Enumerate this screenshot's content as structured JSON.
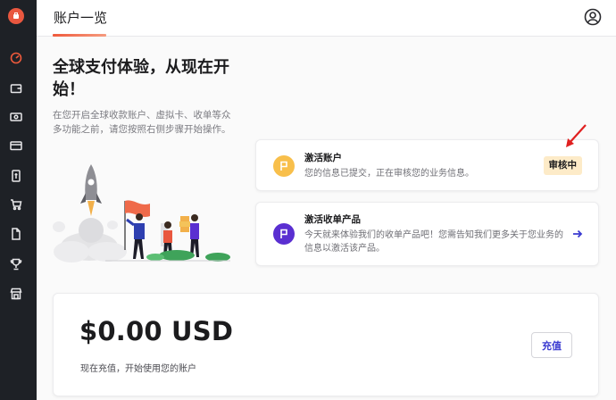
{
  "header": {
    "title": "账户一览"
  },
  "hero": {
    "title": "全球支付体验，从现在开始！",
    "description": "在您开启全球收款账户、虚拟卡、收单等众多功能之前，请您按照右侧步骤开始操作。"
  },
  "tasks": [
    {
      "title": "激活账户",
      "description": "您的信息已提交，正在审核您的业务信息。",
      "status": "审核中",
      "icon": "flag-icon"
    },
    {
      "title": "激活收单产品",
      "description": "今天就来体验我们的收单产品吧！您需告知我们更多关于您业务的信息以激活该产品。",
      "icon": "flag-icon"
    }
  ],
  "balance": {
    "amount": "$0.00 USD",
    "note": "现在充值，开始使用您的账户",
    "button_label": "充值"
  },
  "colors": {
    "accent": "#ef5a3c",
    "sidebar_bg": "#1e2126",
    "flag_yellow": "#f8bf4b",
    "flag_purple": "#5a2fd1",
    "badge_bg": "#fdebc8",
    "link_blue": "#3b3bd1"
  }
}
